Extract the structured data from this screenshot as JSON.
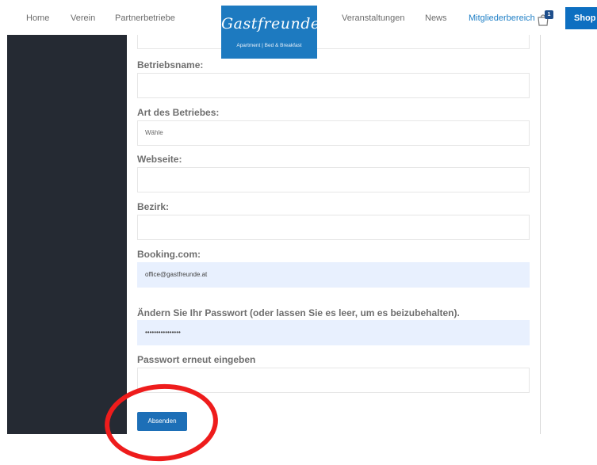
{
  "nav": {
    "home": "Home",
    "verein": "Verein",
    "partnerbetriebe": "Partnerbetriebe",
    "veranstaltungen": "Veranstaltungen",
    "news": "News",
    "mitgliederbereich": "Mitgliederbereich",
    "shop": "Shop",
    "cart_count": "1"
  },
  "logo": {
    "name": "Gastfreunde",
    "tagline": "Apartment | Bed & Breakfast"
  },
  "form": {
    "betriebsname_label": "Betriebsname:",
    "betriebsname_value": "",
    "art_label": "Art des Betriebes:",
    "art_value": "Wähle",
    "webseite_label": "Webseite:",
    "webseite_value": "",
    "bezirk_label": "Bezirk:",
    "bezirk_value": "",
    "booking_label": "Booking.com:",
    "booking_value": "office@gastfreunde.at",
    "passwort_label": "Ändern Sie Ihr Passwort (oder lassen Sie es leer, um es beizubehalten).",
    "passwort_value": "••••••••••••••••",
    "passwort2_label": "Passwort erneut eingeben",
    "passwort2_value": "",
    "submit_label": "Absenden"
  },
  "colors": {
    "accent": "#1d7ac0",
    "sidebar": "#252a33",
    "autofill": "#e8f0fe",
    "annotation": "#ee1c1c"
  }
}
